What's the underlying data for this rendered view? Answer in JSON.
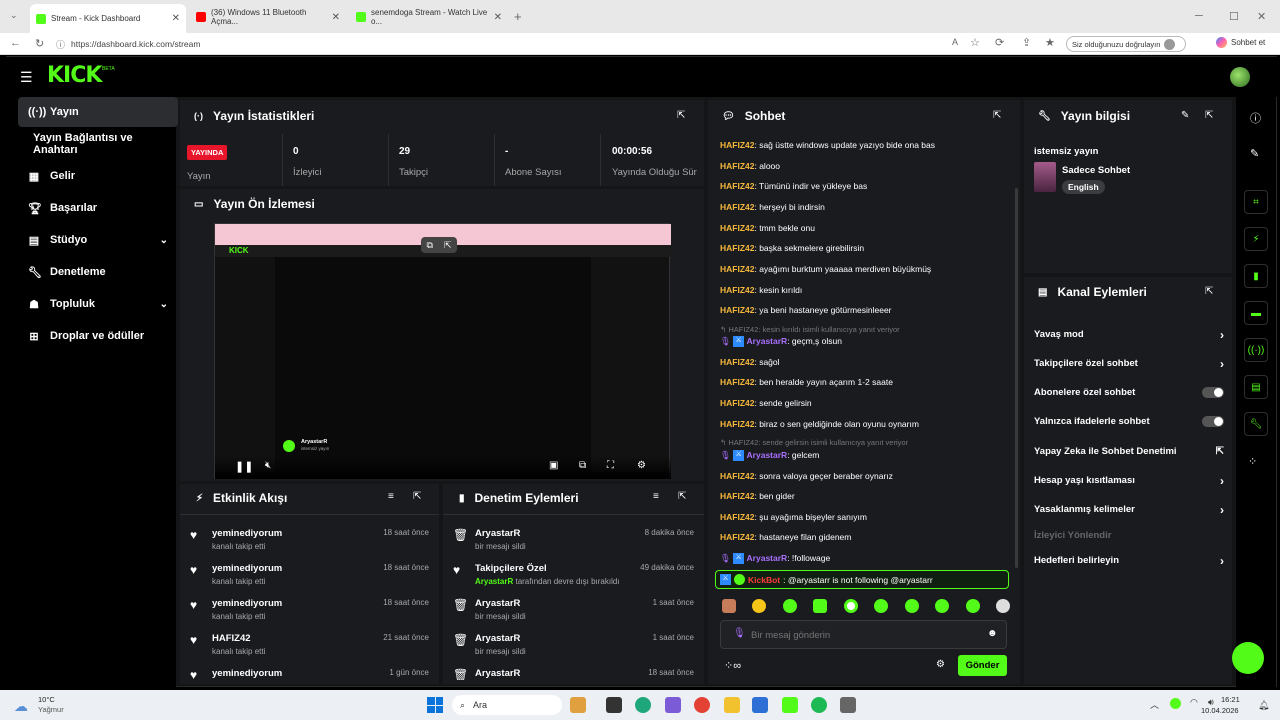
{
  "browser": {
    "tabs": [
      {
        "label": "Stream - Kick Dashboard"
      },
      {
        "label": "(36) Windows 11 Bluetooth Açma..."
      },
      {
        "label": "senemdoga Stream - Watch Live o..."
      }
    ],
    "url": "https://dashboard.kick.com/stream",
    "verify_label": "Siz olduğunuzu doğrulayın",
    "chat_label": "Sohbet et"
  },
  "app": {
    "logo": "KICK",
    "logo_badge": "BETA"
  },
  "sidebar": {
    "items": [
      {
        "label": "Yayın",
        "icon": "broadcast-icon"
      },
      {
        "label": "Yayın Bağlantısı ve Anahtarı",
        "icon": ""
      },
      {
        "label": "Gelir",
        "icon": "revenue-icon"
      },
      {
        "label": "Başarılar",
        "icon": "trophy-icon"
      },
      {
        "label": "Stüdyo",
        "icon": "studio-icon"
      },
      {
        "label": "Denetleme",
        "icon": "wrench-icon"
      },
      {
        "label": "Topluluk",
        "icon": "community-icon"
      },
      {
        "label": "Droplar ve ödüller",
        "icon": "gift-icon"
      }
    ]
  },
  "stats": {
    "title": "Yayın İstatistikleri",
    "live_badge": "YAYINDA",
    "live_label": "Yayın",
    "items": [
      {
        "value": "0",
        "label": "İzleyici"
      },
      {
        "value": "29",
        "label": "Takipçi"
      },
      {
        "value": "-",
        "label": "Abone Sayısı"
      },
      {
        "value": "00:00:56",
        "label": "Yayında Olduğu Süre"
      }
    ]
  },
  "preview": {
    "title": "Yayın Ön İzlemesi",
    "streamer_name": "AryastarR",
    "stream_title": "istemsiz yayın"
  },
  "activity": {
    "title": "Etkinlik Akışı",
    "rows": [
      {
        "name": "yeminediyorum",
        "sub": "kanalı takip etti",
        "time": "18 saat önce"
      },
      {
        "name": "yeminediyorum",
        "sub": "kanalı takip etti",
        "time": "18 saat önce"
      },
      {
        "name": "yeminediyorum",
        "sub": "kanalı takip etti",
        "time": "18 saat önce"
      },
      {
        "name": "HAFIZ42",
        "sub": "kanalı takip etti",
        "time": "21 saat önce"
      },
      {
        "name": "yeminediyorum",
        "sub": "",
        "time": "1 gün önce"
      }
    ]
  },
  "moderation": {
    "title": "Denetim Eylemleri",
    "rows": [
      {
        "name": "AryastarR",
        "sub": "bir mesajı sildi",
        "time": "8 dakika önce",
        "icon": "trash-icon"
      },
      {
        "name": "Takipçilere Özel",
        "sub_user": "AryastarR",
        "sub": " tarafından devre dışı bırakıldı",
        "time": "49 dakika önce",
        "icon": "heart-icon"
      },
      {
        "name": "AryastarR",
        "sub": "bir mesajı sildi",
        "time": "1 saat önce",
        "icon": "trash-icon"
      },
      {
        "name": "AryastarR",
        "sub": "bir mesajı sildi",
        "time": "1 saat önce",
        "icon": "trash-icon"
      },
      {
        "name": "AryastarR",
        "sub": "",
        "time": "18 saat önce",
        "icon": "trash-icon"
      }
    ]
  },
  "chat": {
    "title": "Sohbet",
    "messages": [
      {
        "user": "HAFIZ42",
        "text": ": sağ üstte windows update yazıyo bide ona bas"
      },
      {
        "user": "HAFIZ42",
        "text": ": alooo"
      },
      {
        "user": "HAFIZ42",
        "text": ": Tümünü indir ve yükleye bas"
      },
      {
        "user": "HAFIZ42",
        "text": ": herşeyi bi indirsin"
      },
      {
        "user": "HAFIZ42",
        "text": ": tmm bekle onu"
      },
      {
        "user": "HAFIZ42",
        "text": ": başka sekmelere girebilirsin"
      },
      {
        "user": "HAFIZ42",
        "text": ": ayağımı burktum yaaaaa merdiven büyükmüş"
      },
      {
        "user": "HAFIZ42",
        "text": ": kesin kırıldı"
      },
      {
        "user": "HAFIZ42",
        "text": ": ya beni hastaneye götürmesinleeer"
      }
    ],
    "reply1": "HAFIZ42: kesin kırıldı isimli kullanıcıya yanıt veriyor",
    "reply1_msg": {
      "user": "AryastarR",
      "text": ": geçm,ş olsun"
    },
    "messages2": [
      {
        "user": "HAFIZ42",
        "text": ": sağol"
      },
      {
        "user": "HAFIZ42",
        "text": ": ben heralde yayın açarım 1-2 saate"
      },
      {
        "user": "HAFIZ42",
        "text": ": sende gelirsin"
      },
      {
        "user": "HAFIZ42",
        "text": ": biraz o sen geldiğinde olan oyunu oynarım"
      }
    ],
    "reply2": "HAFIZ42: sende gelirsin isimli kullanıcıya yanıt veriyor",
    "reply2_msg": {
      "user": "AryastarR",
      "text": ": gelcem"
    },
    "messages3": [
      {
        "user": "HAFIZ42",
        "text": ": sonra valoya geçer beraber oynarız"
      },
      {
        "user": "HAFIZ42",
        "text": ": ben gider"
      },
      {
        "user": "HAFIZ42",
        "text": ": şu ayağıma bişeyler sanıyım"
      },
      {
        "user": "HAFIZ42",
        "text": ": hastaneye filan gidenem"
      }
    ],
    "last_msg": {
      "user": "AryastarR",
      "text": ": !followage"
    },
    "bot_msg": {
      "user": "KickBot",
      "text": ": @aryastarr is not following @aryastarr"
    },
    "input_placeholder": "Bir mesaj gönderin",
    "send_label": "Gönder"
  },
  "stream_info": {
    "title": "Yayın bilgisi",
    "stream_title": "istemsiz yayın",
    "category": "Sadece Sohbet",
    "language": "English"
  },
  "channel_actions": {
    "title": "Kanal Eylemleri",
    "rows": [
      {
        "label": "Yavaş mod",
        "kind": "chevron"
      },
      {
        "label": "Takipçilere özel sohbet",
        "kind": "chevron"
      },
      {
        "label": "Abonelere özel sohbet",
        "kind": "toggle"
      },
      {
        "label": "Yalnızca ifadelerle sohbet",
        "kind": "toggle"
      },
      {
        "label": "Yapay Zeka ile Sohbet Denetimi",
        "kind": "external"
      },
      {
        "label": "Hesap yaşı kısıtlaması",
        "kind": "chevron"
      },
      {
        "label": "Yasaklanmış kelimeler",
        "kind": "chevron"
      },
      {
        "label": "İzleyici Yönlendir",
        "kind": "disabled"
      },
      {
        "label": "Hedefleri belirleyin",
        "kind": "chevron"
      }
    ]
  },
  "taskbar": {
    "weather_temp": "10°C",
    "weather_desc": "Yağmur",
    "search_label": "Ara",
    "time": "16:21",
    "date": "10.04.2026"
  },
  "colors": {
    "brand": "#53fc18",
    "live": "#e8162b",
    "chat_user": "#f5b73b",
    "broadcaster": "#a970ff"
  }
}
